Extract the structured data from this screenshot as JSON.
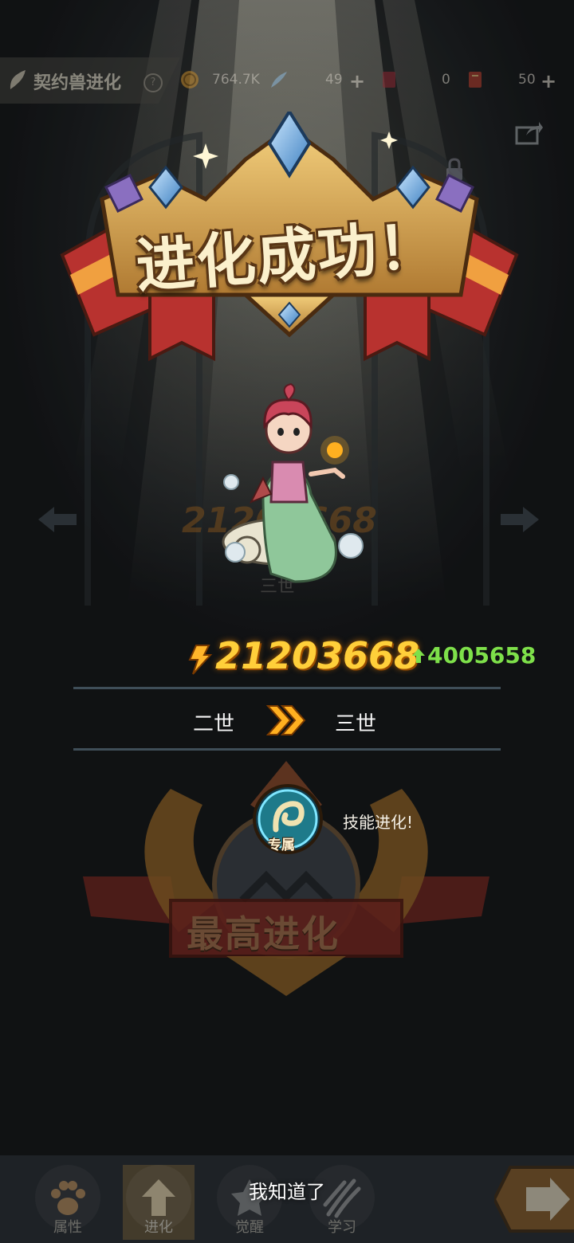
{
  "header": {
    "title": "契约兽进化",
    "help_label": "?",
    "resources": [
      {
        "icon": "gold-coin-icon",
        "value": "764.7K"
      },
      {
        "icon": "feather-crystal-icon",
        "value": "49"
      },
      {
        "icon": "red-card-icon",
        "value": "0"
      },
      {
        "icon": "scroll-card-icon",
        "value": "50"
      }
    ],
    "plus_label": "+"
  },
  "background": {
    "power": "21203668",
    "stage": "三世"
  },
  "banner": {
    "title": "进化成功！"
  },
  "result": {
    "power": "21203668",
    "power_increase": "4005658",
    "from_stage": "二世",
    "to_stage": "三世"
  },
  "skill": {
    "tag": "专属",
    "message": "技能进化!"
  },
  "emblem": {
    "label": "最高进化"
  },
  "bottom_nav": {
    "tabs": [
      {
        "label": "属性",
        "icon": "paw-icon"
      },
      {
        "label": "进化",
        "icon": "up-arrow-icon"
      },
      {
        "label": "觉醒",
        "icon": "awaken-icon"
      },
      {
        "label": "学习",
        "icon": "claw-icon"
      }
    ],
    "active_tab": "进化",
    "confirm_label": "我知道了"
  },
  "colors": {
    "power": "#ffcf3a",
    "increase": "#7ee04a",
    "banner_text": "#fbf0cc"
  }
}
